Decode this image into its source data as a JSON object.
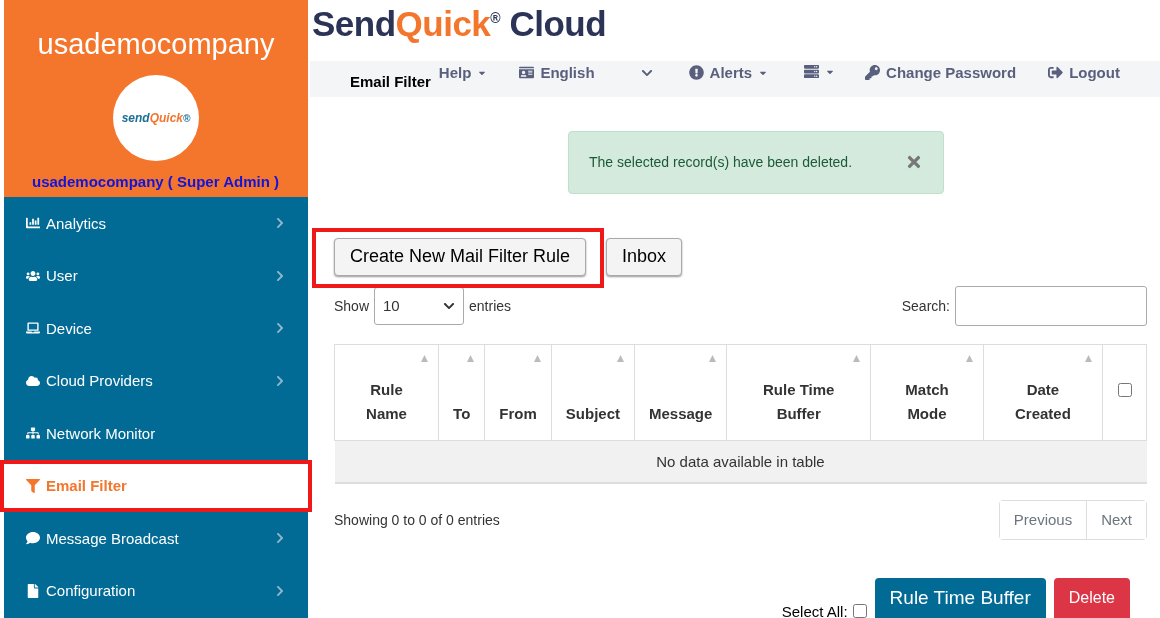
{
  "sidebar": {
    "company": "usademocompany",
    "logo_text": "send",
    "logo_accent": "Quick",
    "logo_mark": "®",
    "user": "usademocompany ( Super Admin )",
    "items": [
      {
        "label": "Analytics",
        "selected": false,
        "has_submenu": true,
        "highlighted": false
      },
      {
        "label": "User",
        "selected": false,
        "has_submenu": true,
        "highlighted": false
      },
      {
        "label": "Device",
        "selected": false,
        "has_submenu": true,
        "highlighted": false
      },
      {
        "label": "Cloud Providers",
        "selected": false,
        "has_submenu": true,
        "highlighted": false
      },
      {
        "label": "Network Monitor",
        "selected": false,
        "has_submenu": false,
        "highlighted": false
      },
      {
        "label": "Email Filter",
        "selected": true,
        "has_submenu": false,
        "highlighted": true
      },
      {
        "label": "Message Broadcast",
        "selected": false,
        "has_submenu": true,
        "highlighted": false
      },
      {
        "label": "Configuration",
        "selected": false,
        "has_submenu": true,
        "highlighted": false
      }
    ]
  },
  "brand": {
    "first": "Send",
    "accent": "Quick",
    "mark": "®",
    "last": " Cloud"
  },
  "navbar": {
    "page_title": "Email Filter",
    "items": [
      "Help",
      "English",
      "Alerts",
      "Change Password",
      "Logout"
    ]
  },
  "alert": {
    "message": "The selected record(s) have been deleted."
  },
  "actions": [
    {
      "label": "Create New Mail Filter Rule",
      "highlighted": true
    },
    {
      "label": "Inbox",
      "highlighted": false
    }
  ],
  "length": {
    "before": "Show",
    "value": "10",
    "after": "entries"
  },
  "search": {
    "label": "Search:"
  },
  "table": {
    "columns": [
      "Rule Name",
      "To",
      "From",
      "Subject",
      "Message",
      "Rule Time Buffer",
      "Match Mode",
      "Date Created"
    ],
    "select_all_checked": false,
    "empty": "No data available in table"
  },
  "info": "Showing 0 to 0 of 0 entries",
  "pagination": [
    "Previous",
    "Next"
  ],
  "footer": {
    "select_all": "Select All:",
    "select_all_checked": false,
    "buttons": [
      {
        "label": "Rule Time Buffer",
        "kind": "primary"
      },
      {
        "label": "Delete",
        "kind": "danger"
      }
    ]
  }
}
